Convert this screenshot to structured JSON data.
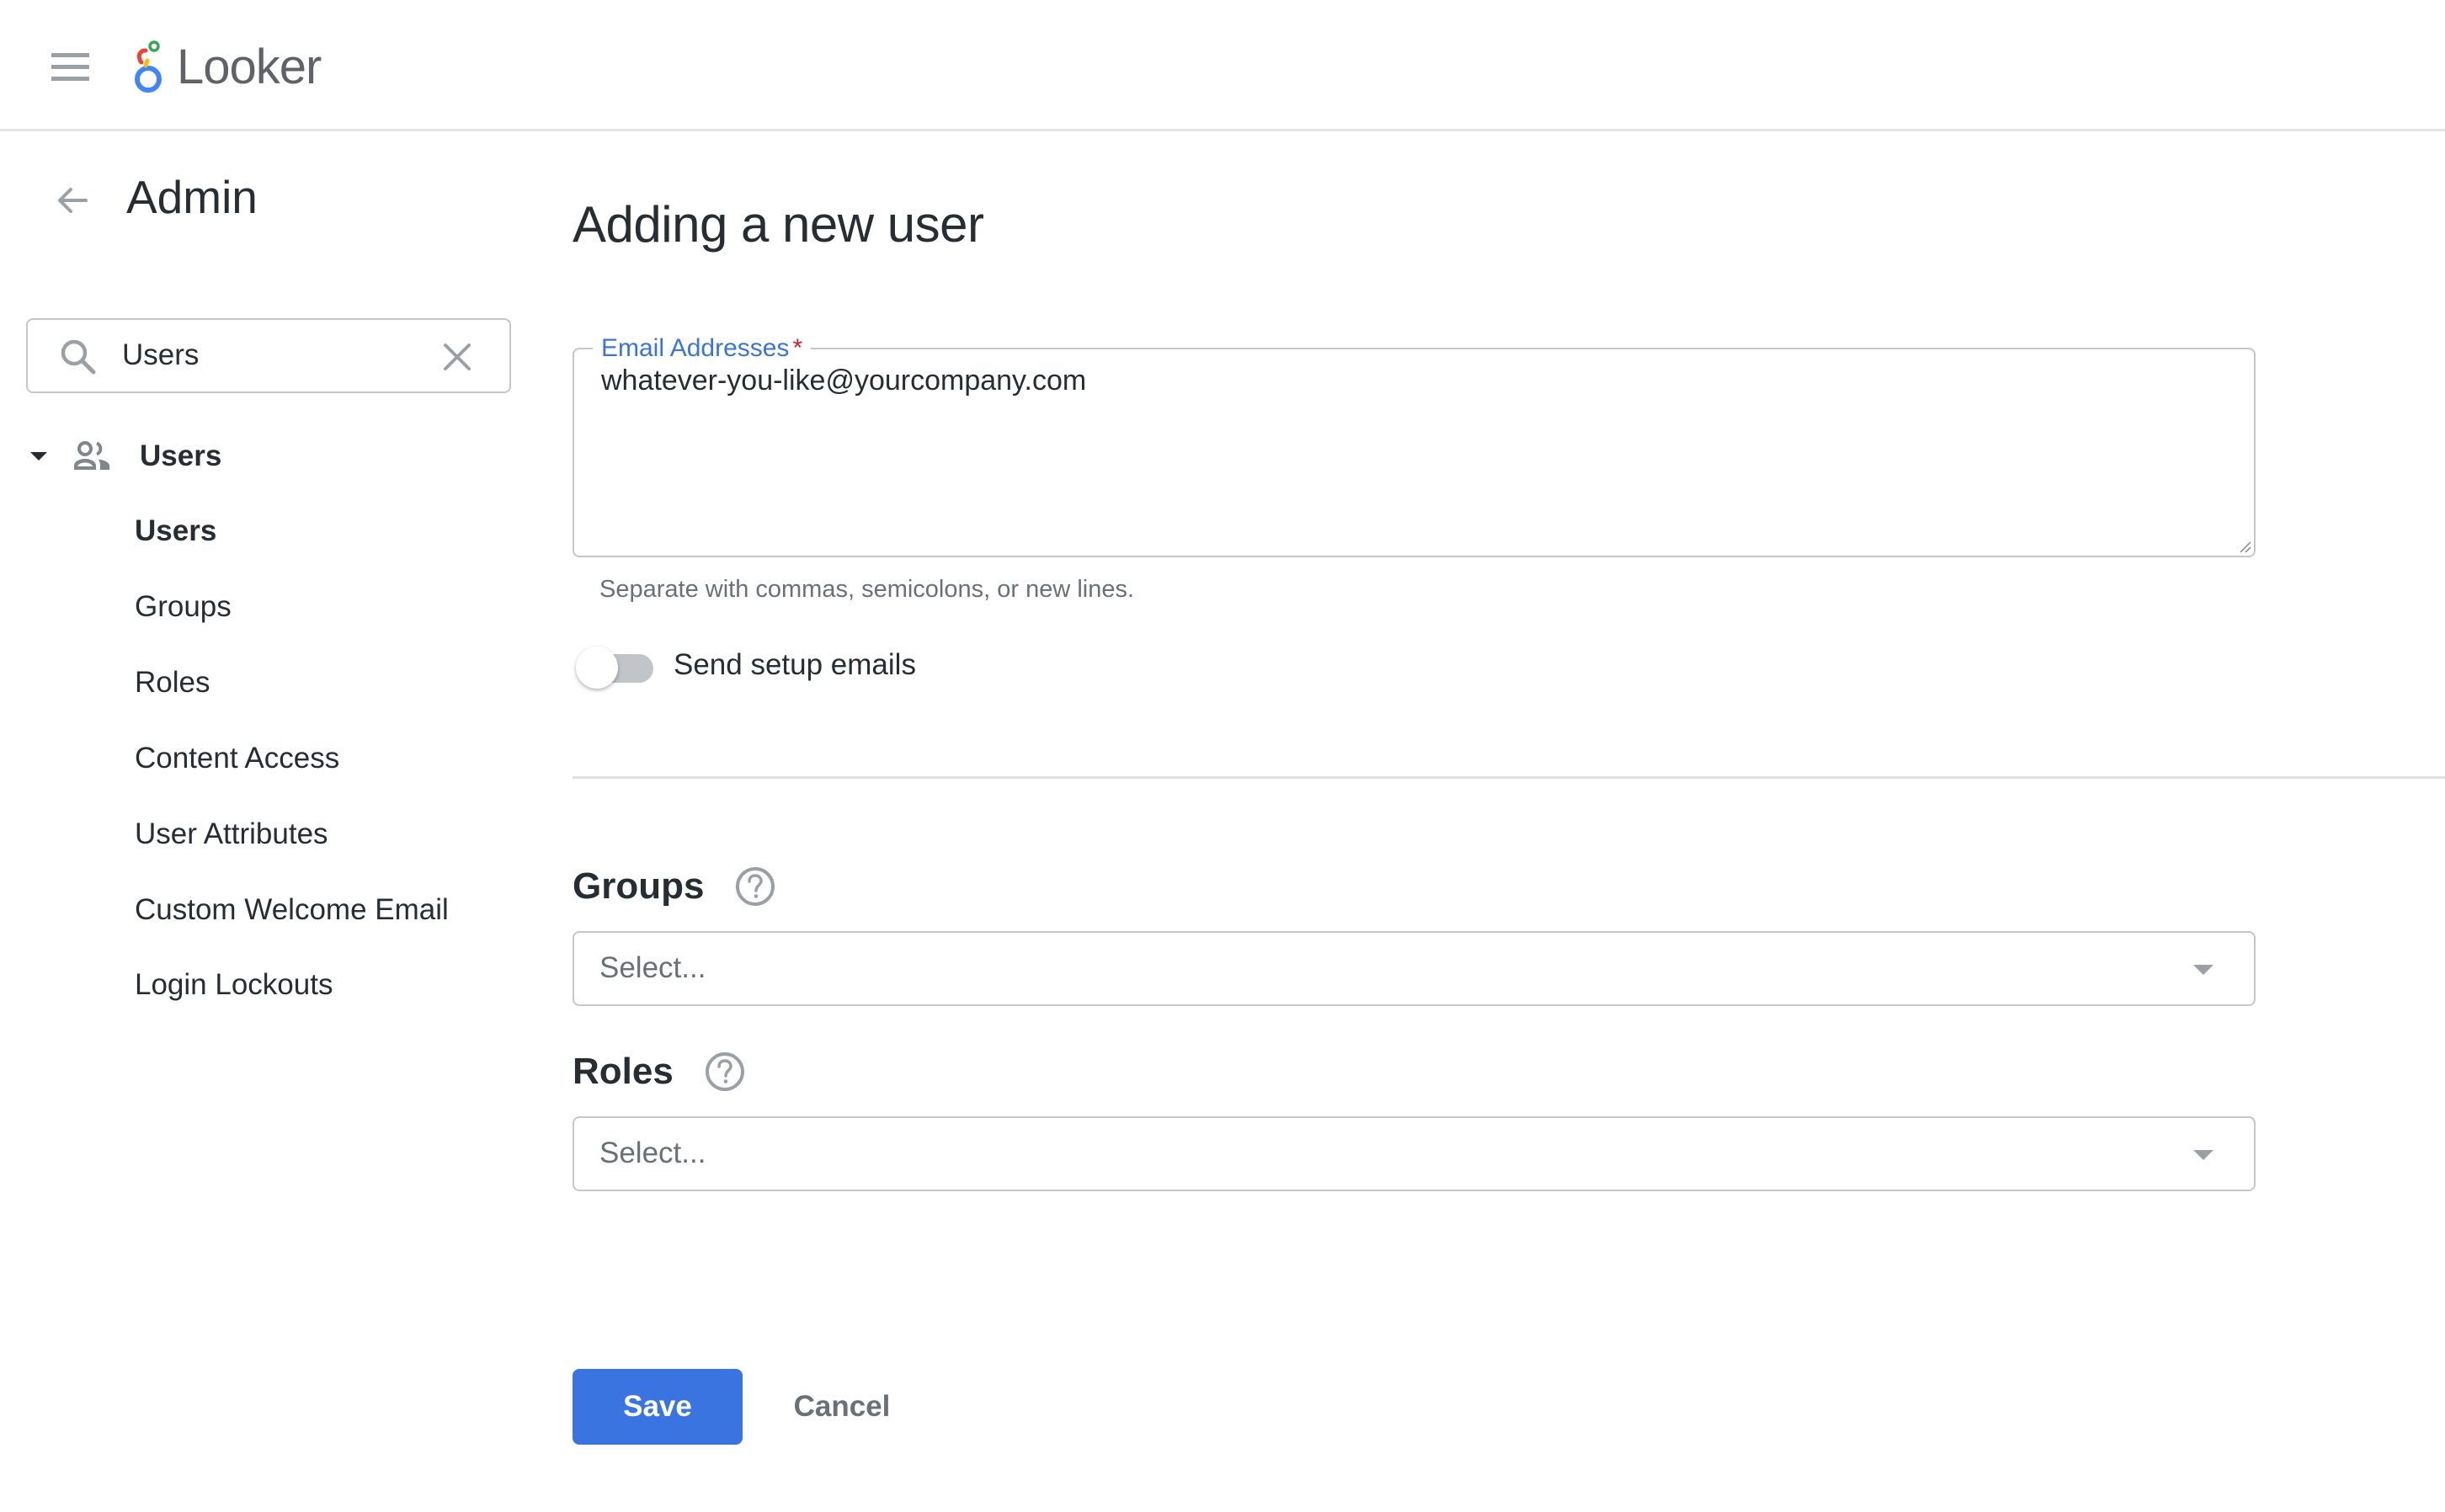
{
  "header": {
    "app_name": "Looker",
    "menu_icon": "hamburger-menu-icon",
    "logo_icon": "looker-logo-icon"
  },
  "sidebar": {
    "back_icon": "arrow-left-icon",
    "title": "Admin",
    "search": {
      "value": "Users",
      "search_icon": "search-icon",
      "clear_icon": "close-icon"
    },
    "group": {
      "label": "Users",
      "expanded": true,
      "icon": "people-icon",
      "items": [
        {
          "label": "Users",
          "active": true
        },
        {
          "label": "Groups",
          "active": false
        },
        {
          "label": "Roles",
          "active": false
        },
        {
          "label": "Content Access",
          "active": false
        },
        {
          "label": "User Attributes",
          "active": false
        },
        {
          "label": "Custom Welcome Email",
          "active": false
        },
        {
          "label": "Login Lockouts",
          "active": false
        }
      ]
    }
  },
  "main": {
    "title": "Adding a new user",
    "email_field": {
      "label": "Email Addresses",
      "required_marker": "*",
      "value": "whatever-you-like@yourcompany.com",
      "helper": "Separate with commas, semicolons, or new lines."
    },
    "send_setup_emails": {
      "label": "Send setup emails",
      "checked": false
    },
    "groups": {
      "heading": "Groups",
      "placeholder": "Select...",
      "help_icon": "help-circle-icon"
    },
    "roles": {
      "heading": "Roles",
      "placeholder": "Select...",
      "help_icon": "help-circle-icon"
    },
    "actions": {
      "save_label": "Save",
      "cancel_label": "Cancel"
    }
  },
  "colors": {
    "primary": "#3a74e0",
    "label_accent": "#3a74de",
    "required": "#cc1f36",
    "text": "#262d33",
    "muted_text": "#6a7078",
    "border": "#c4c7ca"
  }
}
